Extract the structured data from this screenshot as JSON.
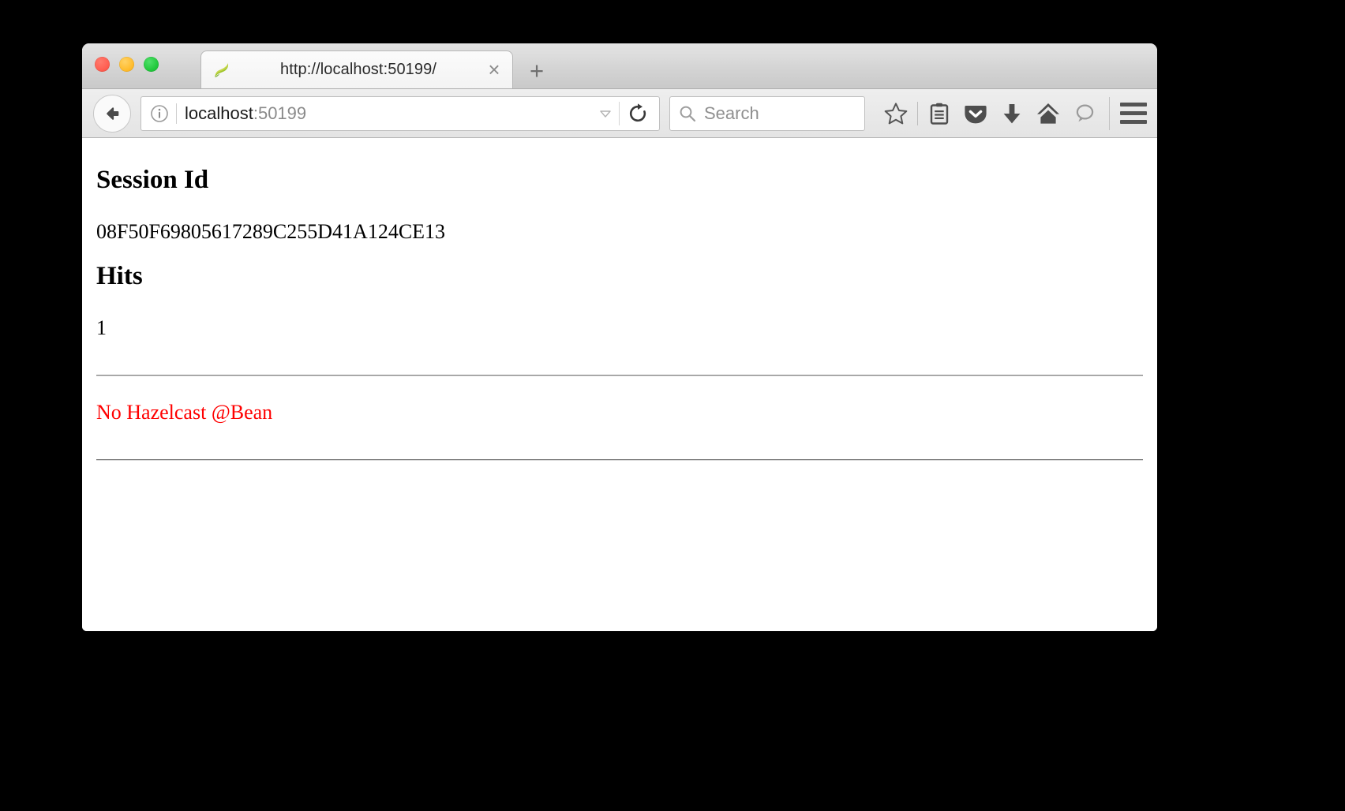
{
  "window": {
    "traffic_lights": [
      {
        "name": "close",
        "color": "#ff5f52"
      },
      {
        "name": "minimize",
        "color": "#ffbd2e"
      },
      {
        "name": "zoom",
        "color": "#23c93d"
      }
    ]
  },
  "tabs": [
    {
      "title": "http://localhost:50199/",
      "favicon": "spring-leaf-icon",
      "close_label": "×",
      "active": true
    }
  ],
  "new_tab": {
    "label": "+",
    "icon": "plus-icon"
  },
  "toolbar": {
    "back": {
      "icon": "back-arrow-icon",
      "label": ""
    },
    "identity": {
      "icon": "info-circle-icon"
    },
    "url": {
      "host": "localhost",
      "port": ":50199",
      "full": "localhost:50199",
      "dropmarker_icon": "chevron-down-icon"
    },
    "reload": {
      "icon": "reload-icon"
    },
    "search": {
      "icon": "search-icon",
      "placeholder": "Search",
      "value": ""
    },
    "icons": [
      {
        "name": "bookmark-star-icon",
        "title": "Bookmark this page"
      },
      {
        "name": "reading-list-icon",
        "title": "Show your bookmarks"
      },
      {
        "name": "pocket-icon",
        "title": "Save to Pocket"
      },
      {
        "name": "downloads-icon",
        "title": "Downloads"
      },
      {
        "name": "home-icon",
        "title": "Home"
      },
      {
        "name": "sync-chat-icon",
        "title": "Firefox Account"
      }
    ],
    "menu": {
      "icon": "hamburger-menu-icon",
      "label": "Open menu"
    }
  },
  "page": {
    "session_heading": "Session Id",
    "session_id": "08F50F69805617289C255D41A124CE13",
    "hits_heading": "Hits",
    "hits_value": "1",
    "alert_message": "No Hazelcast @Bean",
    "alert_color": "#ff0000"
  }
}
